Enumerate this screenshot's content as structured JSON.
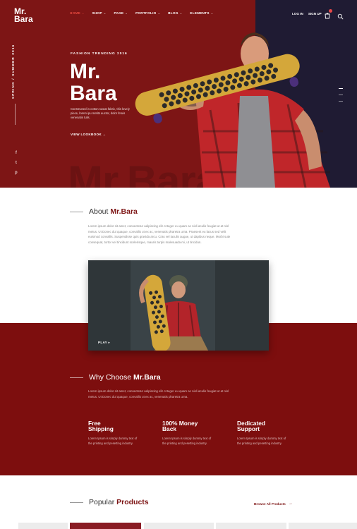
{
  "logo": {
    "line1": "Mr.",
    "line2": "Bara"
  },
  "nav": {
    "items": [
      {
        "label": "HOME",
        "active": true
      },
      {
        "label": "SHOP",
        "active": false
      },
      {
        "label": "PAGE",
        "active": false
      },
      {
        "label": "PORTFOLIO",
        "active": false
      },
      {
        "label": "BLOG",
        "active": false
      },
      {
        "label": "ELEMENTS",
        "active": false
      }
    ],
    "caret": "⌄",
    "login": "LOG IN",
    "signup": "SIGN UP"
  },
  "hero": {
    "season": "SPRING / SUMMER 2016",
    "tagline": "FASHION TRENDING 2016",
    "title_line1": "Mr.",
    "title_line2": "Bara",
    "description": "Constructed in cotton sweat fabric, this lovely piece, lorem ipu metits auctor, dolor fetuis venenatis tulis.",
    "link": "VIEW LOOKBOOK",
    "arrow": "→",
    "watermark": "Mr.Bara",
    "social": [
      "f",
      "t",
      "p"
    ],
    "slider_active": 0
  },
  "about": {
    "heading_prefix": "About",
    "heading_brand": "Mr.Bara",
    "text": "Lorem ipsum dolor sit amet, consectetur adipiscing elit. Integer eu quam ac nisl iaculis feugiat ut at nisl metus. Ut Donec dui quaque, convallis ut ex ac, venenatis pharetra urna. Praesent eu lacus sed velit euismod convallis. Suspendisse quis gravida arcu. Cras vel iaculis augue, ut dapibus neque. Morbi sute consequat, tortor vel tincidunt scelerisque, mauris turpis malesuada mi, ut tincidun."
  },
  "video": {
    "play_label": "PLAY",
    "play_icon": "▸"
  },
  "why": {
    "heading_prefix": "Why Choose",
    "heading_brand": "Mr.Bara",
    "text": "Lorem ipsum dolor sit amet, consectetur adipiscing elit. Integer eu quam ac nisl iaculis feugiat ut at nisl metus. Ut Donec dui quaque, convallis ut ex ac, venenatis pharetra urna.",
    "features": [
      {
        "title_l1": "Free",
        "title_l2": "Shipping",
        "text": "Lorem Ipsum is simply dummy text of the printing and pesetting industry."
      },
      {
        "title_l1": "100% Money",
        "title_l2": "Back",
        "text": "Lorem Ipsum is simply dummy text of the printing and pesetting industry."
      },
      {
        "title_l1": "Dedicated",
        "title_l2": "Support",
        "text": "Lorem Ipsum is simply dummy text of the printing and pesetting industry."
      }
    ]
  },
  "popular": {
    "heading_prefix": "Popular",
    "heading_brand": "Products",
    "browse": "Browse All Products",
    "arrow": "→"
  },
  "colors": {
    "brand": "#7d1515",
    "hero_dark": "#1f1b33",
    "accent": "#e8493f",
    "why_bg": "#7d0e0e"
  },
  "icons": [
    "cart-icon",
    "search-icon",
    "facebook-icon",
    "twitter-icon",
    "pinterest-icon",
    "arrow-right-icon",
    "play-icon"
  ]
}
